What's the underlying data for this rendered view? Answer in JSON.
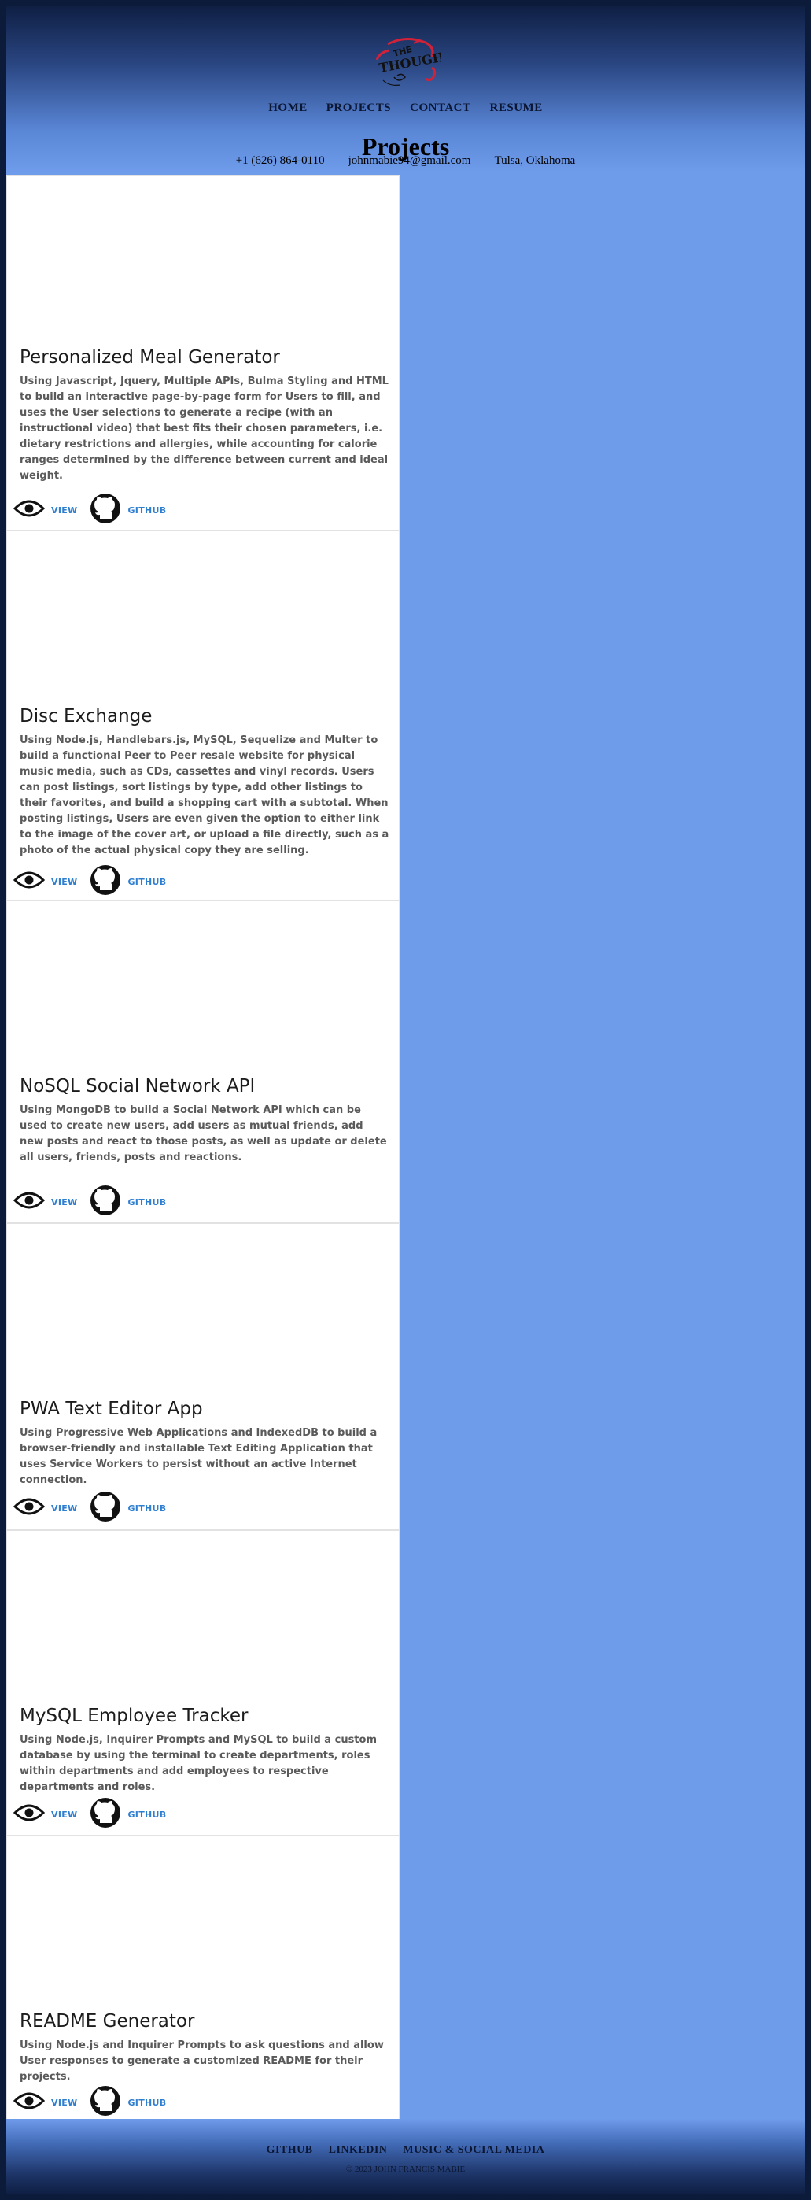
{
  "header": {
    "logo_alt": "The Thought",
    "nav": [
      "HOME",
      "PROJECTS",
      "CONTACT",
      "RESUME"
    ]
  },
  "page_title": "Projects",
  "contact": {
    "phone": "+1 (626) 864-0110",
    "email": "johnmabie94@gmail.com",
    "location": "Tulsa, Oklahoma"
  },
  "projects": [
    {
      "title": "Personalized Meal Generator",
      "description": "Using Javascript, Jquery, Multiple APIs, Bulma Styling and HTML to build an interactive page-by-page form for Users to fill, and uses the User selections to generate a recipe (with an instructional video) that best fits their chosen parameters, i.e. dietary restrictions and allergies, while accounting for calorie ranges determined by the difference between current and ideal weight.",
      "view_label": "VIEW",
      "github_label": "GITHUB"
    },
    {
      "title": "Disc Exchange",
      "description": "Using Node.js, Handlebars.js, MySQL, Sequelize and Multer to build a functional Peer to Peer resale website for physical music media, such as CDs, cassettes and vinyl records. Users can post listings, sort listings by type, add other listings to their favorites, and build a shopping cart with a subtotal. When posting listings, Users are even given the option to either link to the image of the cover art, or upload a file directly, such as a photo of the actual physical copy they are selling.",
      "view_label": "VIEW",
      "github_label": "GITHUB"
    },
    {
      "title": "NoSQL Social Network API",
      "description": "Using MongoDB to build a Social Network API which can be used to create new users, add users as mutual friends, add new posts and react to those posts, as well as update or delete all users, friends, posts and reactions.",
      "view_label": "VIEW",
      "github_label": "GITHUB"
    },
    {
      "title": "PWA Text Editor App",
      "description": "Using Progressive Web Applications and IndexedDB to build a browser-friendly and installable Text Editing Application that uses Service Workers to persist without an active Internet connection.",
      "view_label": "VIEW",
      "github_label": "GITHUB"
    },
    {
      "title": "MySQL Employee Tracker",
      "description": "Using Node.js, Inquirer Prompts and MySQL to build a custom database by using the terminal to create departments, roles within departments and add employees to respective departments and roles.",
      "view_label": "VIEW",
      "github_label": "GITHUB"
    },
    {
      "title": "README Generator",
      "description": "Using Node.js and Inquirer Prompts to ask questions and allow User responses to generate a customized README for their projects.",
      "view_label": "VIEW",
      "github_label": "GITHUB"
    }
  ],
  "footer": {
    "links": [
      "GITHUB",
      "LINKEDIN",
      "MUSIC & SOCIAL MEDIA"
    ],
    "copyright": "© 2023 JOHN FRANCIS MABIE"
  },
  "icons": {
    "view": "eye-icon",
    "github": "github-icon"
  },
  "colors": {
    "accent": "#2f7fd1",
    "background": "#6f9beb",
    "header_dark": "#0f1f44"
  }
}
